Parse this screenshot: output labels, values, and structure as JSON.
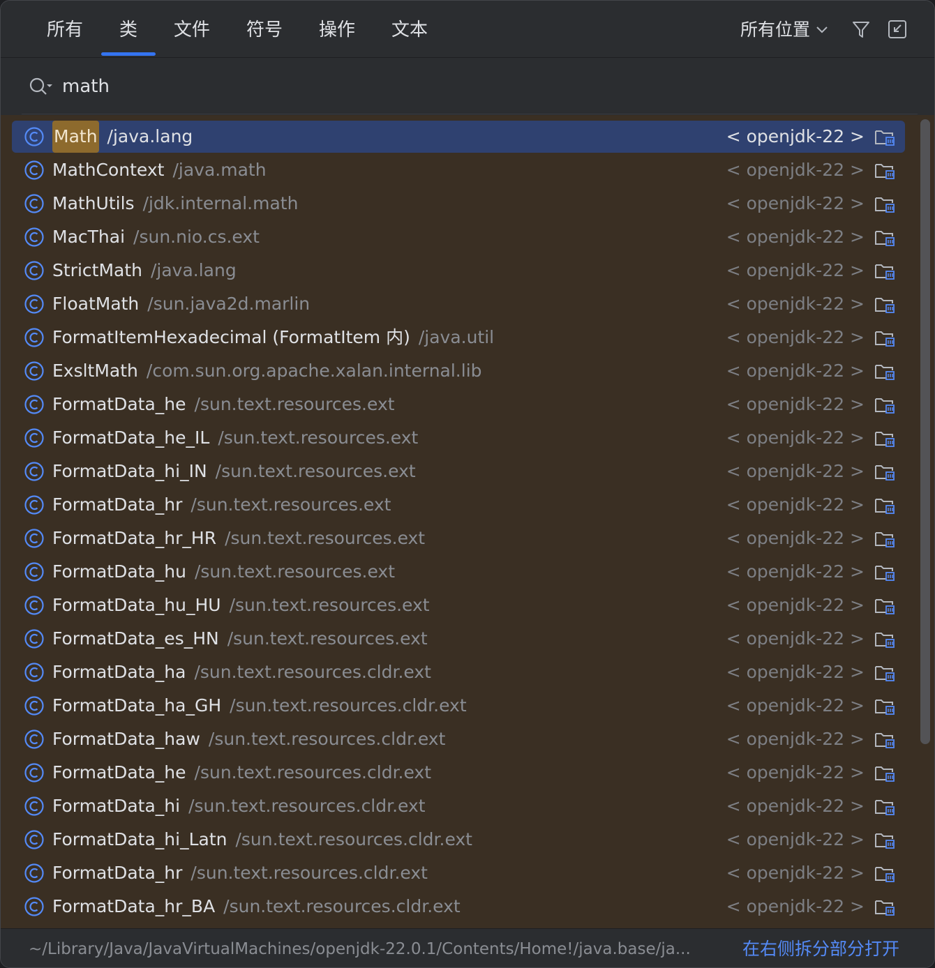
{
  "tabs": [
    {
      "label": "所有"
    },
    {
      "label": "类"
    },
    {
      "label": "文件"
    },
    {
      "label": "符号"
    },
    {
      "label": "操作"
    },
    {
      "label": "文本"
    }
  ],
  "active_tab": "类",
  "scope": {
    "label": "所有位置",
    "icon": "chevron-down-icon"
  },
  "header_icons": [
    "filter-icon",
    "collapse-window-icon"
  ],
  "search": {
    "value": "math",
    "icon": "search-icon"
  },
  "results": [
    {
      "highlight": "Math",
      "name": "",
      "package": "/java.lang",
      "location": "< openjdk-22 >",
      "icon": "class-icon",
      "selected": true
    },
    {
      "highlight": "",
      "name": "MathContext",
      "package": "/java.math",
      "location": "< openjdk-22 >",
      "icon": "class-icon"
    },
    {
      "highlight": "",
      "name": "MathUtils",
      "package": "/jdk.internal.math",
      "location": "< openjdk-22 >",
      "icon": "class-icon"
    },
    {
      "highlight": "",
      "name": "MacThai",
      "package": "/sun.nio.cs.ext",
      "location": "< openjdk-22 >",
      "icon": "class-icon"
    },
    {
      "highlight": "",
      "name": "StrictMath",
      "package": "/java.lang",
      "location": "< openjdk-22 >",
      "icon": "class-icon"
    },
    {
      "highlight": "",
      "name": "FloatMath",
      "package": "/sun.java2d.marlin",
      "location": "< openjdk-22 >",
      "icon": "class-icon"
    },
    {
      "highlight": "",
      "name": "FormatItemHexadecimal (FormatItem 内)",
      "package": "/java.util",
      "location": "< openjdk-22 >",
      "icon": "class-icon"
    },
    {
      "highlight": "",
      "name": "ExsltMath",
      "package": "/com.sun.org.apache.xalan.internal.lib",
      "location": "< openjdk-22 >",
      "icon": "class-icon"
    },
    {
      "highlight": "",
      "name": "FormatData_he",
      "package": "/sun.text.resources.ext",
      "location": "< openjdk-22 >",
      "icon": "class-icon"
    },
    {
      "highlight": "",
      "name": "FormatData_he_IL",
      "package": "/sun.text.resources.ext",
      "location": "< openjdk-22 >",
      "icon": "class-icon"
    },
    {
      "highlight": "",
      "name": "FormatData_hi_IN",
      "package": "/sun.text.resources.ext",
      "location": "< openjdk-22 >",
      "icon": "class-icon"
    },
    {
      "highlight": "",
      "name": "FormatData_hr",
      "package": "/sun.text.resources.ext",
      "location": "< openjdk-22 >",
      "icon": "class-icon"
    },
    {
      "highlight": "",
      "name": "FormatData_hr_HR",
      "package": "/sun.text.resources.ext",
      "location": "< openjdk-22 >",
      "icon": "class-icon"
    },
    {
      "highlight": "",
      "name": "FormatData_hu",
      "package": "/sun.text.resources.ext",
      "location": "< openjdk-22 >",
      "icon": "class-icon"
    },
    {
      "highlight": "",
      "name": "FormatData_hu_HU",
      "package": "/sun.text.resources.ext",
      "location": "< openjdk-22 >",
      "icon": "class-icon"
    },
    {
      "highlight": "",
      "name": "FormatData_es_HN",
      "package": "/sun.text.resources.ext",
      "location": "< openjdk-22 >",
      "icon": "class-icon"
    },
    {
      "highlight": "",
      "name": "FormatData_ha",
      "package": "/sun.text.resources.cldr.ext",
      "location": "< openjdk-22 >",
      "icon": "class-icon"
    },
    {
      "highlight": "",
      "name": "FormatData_ha_GH",
      "package": "/sun.text.resources.cldr.ext",
      "location": "< openjdk-22 >",
      "icon": "class-icon"
    },
    {
      "highlight": "",
      "name": "FormatData_haw",
      "package": "/sun.text.resources.cldr.ext",
      "location": "< openjdk-22 >",
      "icon": "class-icon"
    },
    {
      "highlight": "",
      "name": "FormatData_he",
      "package": "/sun.text.resources.cldr.ext",
      "location": "< openjdk-22 >",
      "icon": "class-icon"
    },
    {
      "highlight": "",
      "name": "FormatData_hi",
      "package": "/sun.text.resources.cldr.ext",
      "location": "< openjdk-22 >",
      "icon": "class-icon"
    },
    {
      "highlight": "",
      "name": "FormatData_hi_Latn",
      "package": "/sun.text.resources.cldr.ext",
      "location": "< openjdk-22 >",
      "icon": "class-icon"
    },
    {
      "highlight": "",
      "name": "FormatData_hr",
      "package": "/sun.text.resources.cldr.ext",
      "location": "< openjdk-22 >",
      "icon": "class-icon"
    },
    {
      "highlight": "",
      "name": "FormatData_hr_BA",
      "package": "/sun.text.resources.cldr.ext",
      "location": "< openjdk-22 >",
      "icon": "class-icon"
    }
  ],
  "footer": {
    "path": "~/Library/Java/JavaVirtualMachines/openjdk-22.0.1/Contents/Home!/java.base/ja...",
    "open_right_label": "在右侧拆分部分打开"
  },
  "colors": {
    "accent": "#3574f0",
    "selected_row": "#2f4170",
    "list_background": "#3a2f23",
    "highlight": "#8d6a2d",
    "link": "#548af7"
  }
}
